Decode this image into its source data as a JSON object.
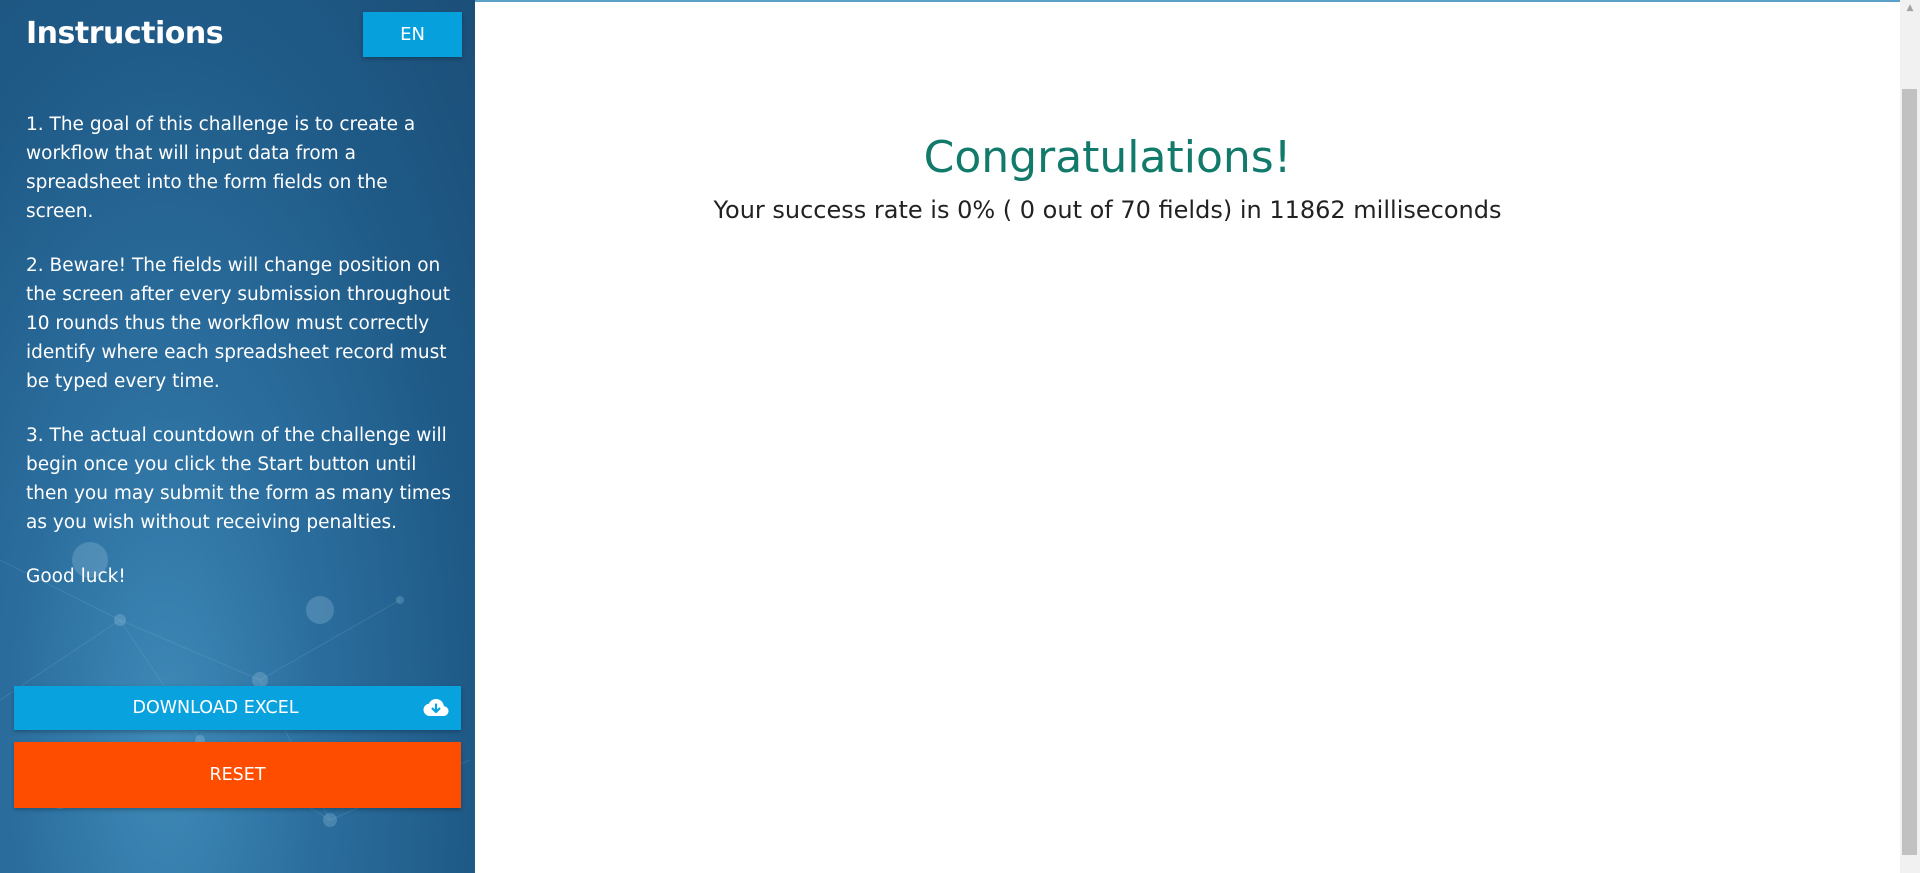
{
  "sidebar": {
    "title": "Instructions",
    "language_button": "EN",
    "instructions": [
      "1. The goal of this challenge is to create a workflow that will input data from a spreadsheet into the form fields on the screen.",
      "2. Beware! The fields will change position on the screen after every submission throughout 10 rounds thus the workflow must correctly identify where each spreadsheet record must be typed every time.",
      "3. The actual countdown of the challenge will begin once you click the Start button until then you may submit the form as many times as you wish without receiving penalties.",
      "Good luck!"
    ],
    "download_button": "DOWNLOAD EXCEL",
    "download_icon": "cloud-download-icon",
    "reset_button": "RESET"
  },
  "main": {
    "heading": "Congratulations!",
    "result_text": "Your success rate is 0% ( 0 out of 70 fields) in 11862 milliseconds"
  },
  "colors": {
    "heading": "#127a6a",
    "language_button": "#06a0dd",
    "download_button": "#08a2df",
    "reset_button": "#ff4d00",
    "sidebar_background": "#1f5a87"
  }
}
